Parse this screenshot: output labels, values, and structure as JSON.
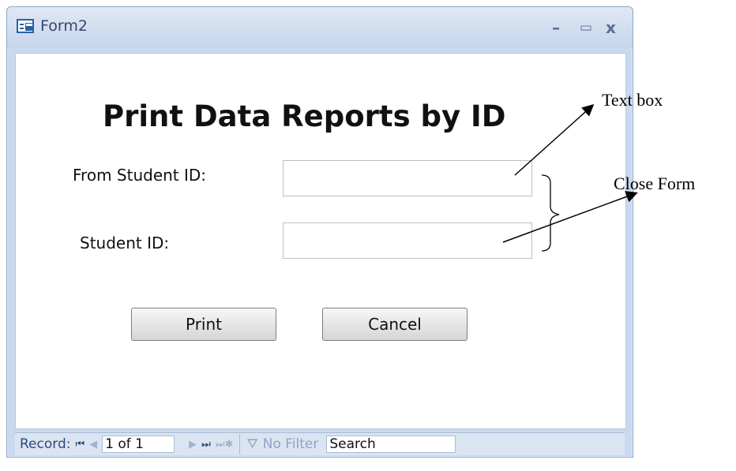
{
  "window": {
    "title": "Form2",
    "controls": {
      "minimize": "–",
      "maximize": "▭",
      "close": "x"
    }
  },
  "form": {
    "heading": "Print Data Reports by ID",
    "fields": [
      {
        "label": "From Student ID:",
        "value": ""
      },
      {
        "label": "Student ID:",
        "value": ""
      }
    ],
    "buttons": {
      "print": "Print",
      "cancel": "Cancel"
    }
  },
  "navigator": {
    "record_label": "Record:",
    "position": "1 of 1",
    "filter_label": "No Filter",
    "search_placeholder": "Search"
  },
  "annotations": {
    "text_box": "Text box",
    "close_form": "Close Form"
  }
}
